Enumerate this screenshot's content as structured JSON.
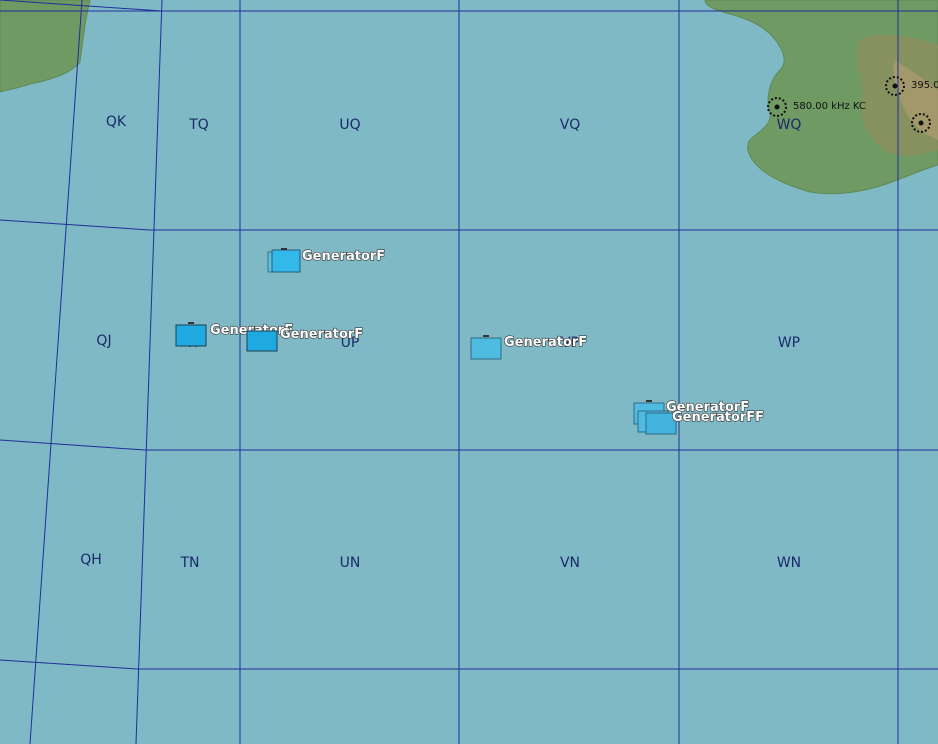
{
  "map": {
    "water_color": "#7fb9c5",
    "land_color": "#6f9a63",
    "grid_color": "#1f2f99",
    "unit_color": "#33b8ea"
  },
  "grid_labels": {
    "qk": "QK",
    "tq": "TQ",
    "uq": "UQ",
    "vq": "VQ",
    "wq": "WQ",
    "qj": "QJ",
    "tp": "TP",
    "up": "UP",
    "vp": "VP",
    "wp": "WP",
    "qh": "QH",
    "tn": "TN",
    "un": "UN",
    "vn": "VN",
    "wn": "WN"
  },
  "units": [
    {
      "label": "GeneratorF"
    },
    {
      "label": "GeneratorF"
    },
    {
      "label": "GeneratorF"
    },
    {
      "label": "GeneratorF"
    },
    {
      "label": "GeneratorF"
    },
    {
      "label": "GeneratorFF"
    }
  ],
  "beacons": [
    {
      "label": "580.00 kHz KC"
    },
    {
      "label": "395.0"
    }
  ]
}
